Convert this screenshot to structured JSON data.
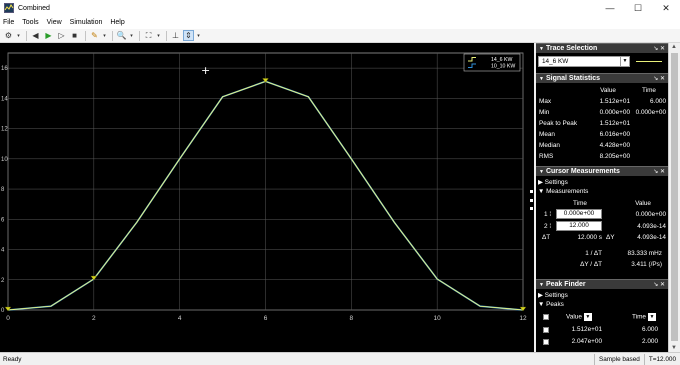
{
  "window": {
    "title": "Combined",
    "controls": [
      "—",
      "☐",
      "✕"
    ]
  },
  "menu": [
    "File",
    "Tools",
    "View",
    "Simulation",
    "Help"
  ],
  "colors": {
    "series_1": "#e8f07a",
    "series_2": "#2f8fd8",
    "marker": "#d6d61e",
    "grid": "#5a5a5a",
    "background": "#000000"
  },
  "chart_data": {
    "type": "line",
    "xlim": [
      0,
      12
    ],
    "ylim": [
      0,
      17
    ],
    "xticks": [
      "0",
      "2",
      "4",
      "6",
      "8",
      "10",
      "12"
    ],
    "yticks": [
      "0",
      "2",
      "4",
      "6",
      "8",
      "10",
      "12",
      "14",
      "16"
    ],
    "grid": true,
    "legend_position": "top-right",
    "series": [
      {
        "name": "14_6 KW",
        "color": "#e8f07a",
        "x": [
          0,
          1,
          2,
          3,
          4,
          5,
          6,
          7,
          8,
          9,
          10,
          11,
          12
        ],
        "y": [
          0,
          0.25,
          2.05,
          5.8,
          10.0,
          14.1,
          15.12,
          14.1,
          10.0,
          5.8,
          2.05,
          0.25,
          0
        ]
      },
      {
        "name": "10_10 KW",
        "color": "#2f8fd8",
        "x": [
          0,
          1,
          2,
          3,
          4,
          5,
          6,
          7,
          8,
          9,
          10,
          11,
          12
        ],
        "y": [
          0,
          0.25,
          2.05,
          5.8,
          10.0,
          14.1,
          15.12,
          14.1,
          10.0,
          5.8,
          2.05,
          0.25,
          0
        ]
      }
    ],
    "markers": [
      {
        "x": 0,
        "y": 0
      },
      {
        "x": 2,
        "y": 2.047
      },
      {
        "x": 6,
        "y": 15.12
      },
      {
        "x": 12,
        "y": 0
      }
    ],
    "cursor_glyph": "+"
  },
  "trace_selection": {
    "title": "Trace Selection",
    "selected": "14_6 KW"
  },
  "signal_statistics": {
    "title": "Signal Statistics",
    "headers": [
      "Value",
      "Time"
    ],
    "rows": [
      {
        "label": "Max",
        "value": "1.512e+01",
        "time": "6.000"
      },
      {
        "label": "Min",
        "value": "0.000e+00",
        "time": "0.000e+00"
      },
      {
        "label": "Peak to Peak",
        "value": "1.512e+01",
        "time": ""
      },
      {
        "label": "Mean",
        "value": "6.016e+00",
        "time": ""
      },
      {
        "label": "Median",
        "value": "4.428e+00",
        "time": ""
      },
      {
        "label": "RMS",
        "value": "8.205e+00",
        "time": ""
      }
    ]
  },
  "cursor_measurements": {
    "title": "Cursor Measurements",
    "settings_label": "Settings",
    "measurements_label": "Measurements",
    "headers": [
      "Time",
      "Value"
    ],
    "rows": [
      {
        "label": "1",
        "time": "0.000e+00",
        "value": "0.000e+00"
      },
      {
        "label": "2",
        "time": "12.000",
        "value": "4.093e-14"
      }
    ],
    "delta": {
      "dt_label": "ΔT",
      "dt_value": "12.000 s",
      "dy_label": "ΔY",
      "dy_value": "4.093e-14"
    },
    "inv_dt_label": "1 / ΔT",
    "inv_dt_value": "83.333 mHz",
    "dy_dt_label": "ΔY / ΔT",
    "dy_dt_value": "3.411 (/Ps)"
  },
  "peak_finder": {
    "title": "Peak Finder",
    "settings_label": "Settings",
    "peaks_label": "Peaks",
    "headers": [
      "Value",
      "Time"
    ],
    "rows": [
      {
        "value": "1.512e+01",
        "time": "6.000"
      },
      {
        "value": "2.047e+00",
        "time": "2.000"
      }
    ]
  },
  "status": {
    "left": "Ready",
    "sample_mode": "Sample based",
    "time": "T=12.000"
  }
}
